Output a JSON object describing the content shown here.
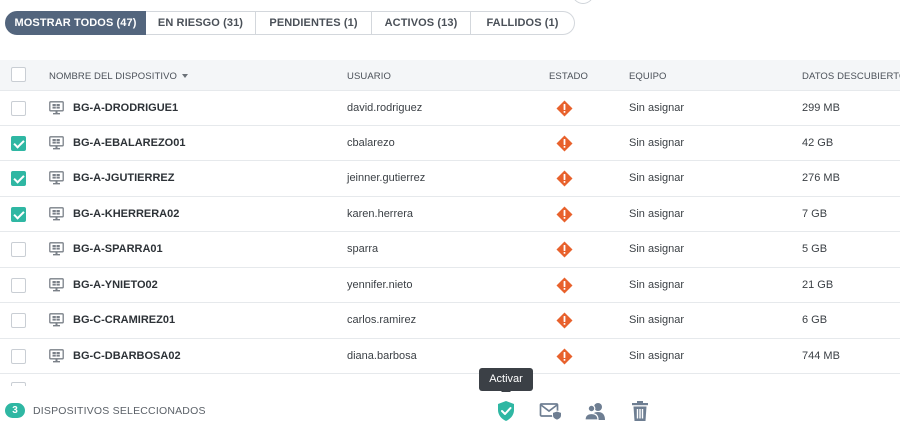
{
  "filters": [
    {
      "label": "MOSTRAR TODOS (47)",
      "active": true
    },
    {
      "label": "EN RIESGO (31)",
      "active": false
    },
    {
      "label": "PENDIENTES (1)",
      "active": false
    },
    {
      "label": "ACTIVOS (13)",
      "active": false
    },
    {
      "label": "FALLIDOS (1)",
      "active": false
    }
  ],
  "table": {
    "columns": {
      "device": "NOMBRE DEL DISPOSITIVO",
      "user": "USUARIO",
      "status": "ESTADO",
      "team": "EQUIPO",
      "data": "DATOS DESCUBIERTOS"
    },
    "sort_icon": "sort-desc-icon",
    "status_icon": "warning-diamond-icon",
    "status_color": "#e8612c",
    "rows": [
      {
        "device": "BG-A-DRODRIGUE1",
        "user": "david.rodriguez",
        "team": "Sin asignar",
        "data": "299 MB",
        "checked": false
      },
      {
        "device": "BG-A-EBALAREZO01",
        "user": "cbalarezo",
        "team": "Sin asignar",
        "data": "42 GB",
        "checked": true
      },
      {
        "device": "BG-A-JGUTIERREZ",
        "user": "jeinner.gutierrez",
        "team": "Sin asignar",
        "data": "276 MB",
        "checked": true
      },
      {
        "device": "BG-A-KHERRERA02",
        "user": "karen.herrera",
        "team": "Sin asignar",
        "data": "7 GB",
        "checked": true
      },
      {
        "device": "BG-A-SPARRA01",
        "user": "sparra",
        "team": "Sin asignar",
        "data": "5 GB",
        "checked": false
      },
      {
        "device": "BG-A-YNIETO02",
        "user": "yennifer.nieto",
        "team": "Sin asignar",
        "data": "21 GB",
        "checked": false
      },
      {
        "device": "BG-C-CRAMIREZ01",
        "user": "carlos.ramirez",
        "team": "Sin asignar",
        "data": "6 GB",
        "checked": false
      },
      {
        "device": "BG-C-DBARBOSA02",
        "user": "diana.barbosa",
        "team": "Sin asignar",
        "data": "744 MB",
        "checked": false
      }
    ]
  },
  "bottom_bar": {
    "selected_count": "3",
    "selected_label": "DISPOSITIVOS SELECCIONADOS",
    "tooltip": "Activar",
    "accent": "#2fb7a3",
    "actions": [
      "shield-check-icon",
      "mail-shield-icon",
      "users-icon",
      "trash-icon"
    ]
  }
}
